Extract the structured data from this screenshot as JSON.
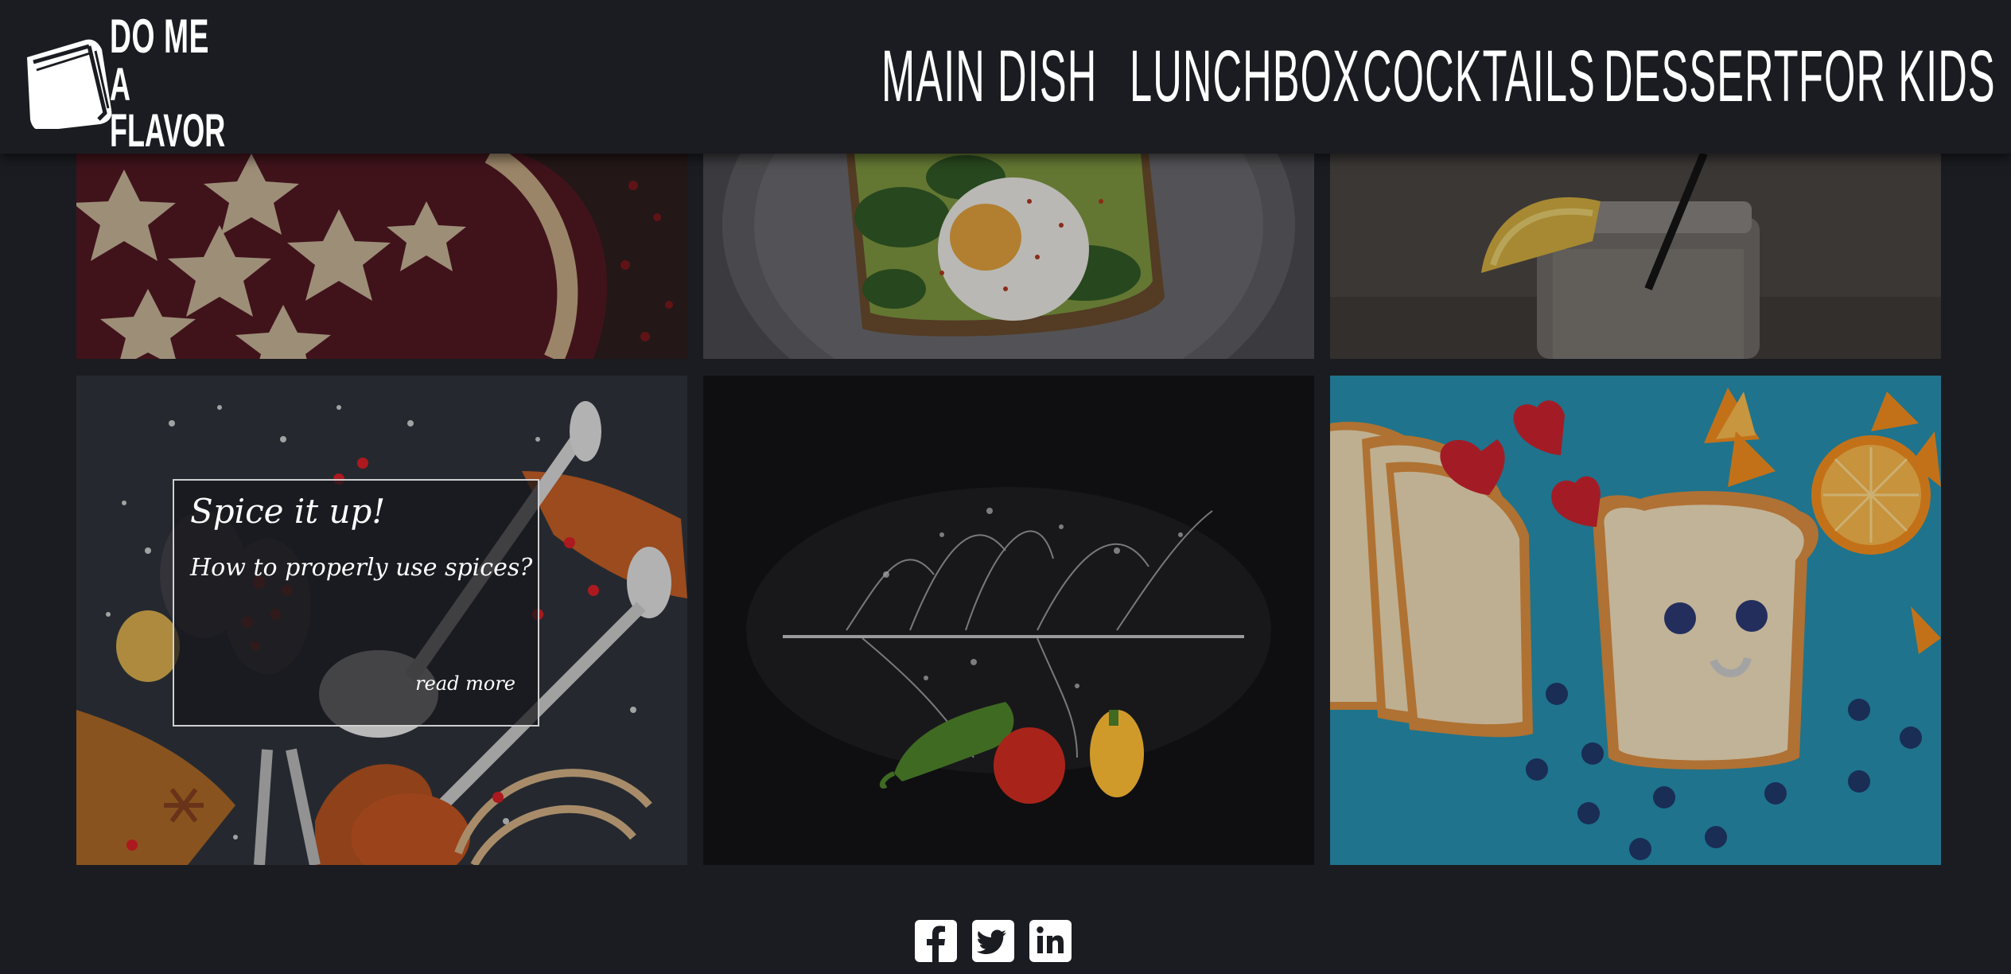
{
  "brand": {
    "line1": "DO ME",
    "line2": "A FLAVOR",
    "icon": "book-icon"
  },
  "nav": {
    "items": [
      {
        "label": "MAIN DISH"
      },
      {
        "label": "LUNCHBOX"
      },
      {
        "label": "COCKTAILS"
      },
      {
        "label": "DESSERT"
      },
      {
        "label": "FOR KIDS"
      }
    ]
  },
  "gallery": {
    "tiles": [
      {
        "subject": "cherry pie with star crust",
        "icon": "pie-photo"
      },
      {
        "subject": "avocado toast with poached egg",
        "icon": "toast-photo"
      },
      {
        "subject": "lemonade in a jar",
        "icon": "drink-photo"
      },
      {
        "subject": "spices on spoons",
        "icon": "spices-photo"
      },
      {
        "subject": "peppers splashing into water",
        "icon": "peppers-photo"
      },
      {
        "subject": "bread smiley face with fruit",
        "icon": "kids-bread-photo"
      }
    ],
    "featured_card": {
      "title": "Spice it up!",
      "subtitle": "How to properly use spices?",
      "link": "read more"
    }
  },
  "footer": {
    "social": [
      {
        "icon": "facebook-icon"
      },
      {
        "icon": "twitter-icon"
      },
      {
        "icon": "linkedin-icon"
      }
    ]
  },
  "colors": {
    "background": "#1b1c21",
    "accent_blue": "#2a9fbd",
    "text": "#ffffff"
  }
}
